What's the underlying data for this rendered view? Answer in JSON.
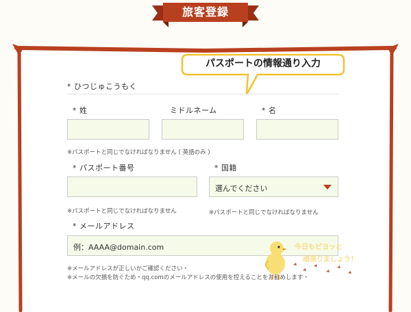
{
  "header": {
    "title": "旅客登録"
  },
  "callout": {
    "text": "パスポートの情報通り入力"
  },
  "kana": {
    "label": "* ひつじゅこうもく"
  },
  "name": {
    "surname_label": "* 姓",
    "middle_label": "ミドルネーム",
    "given_label": "* 名",
    "surname_value": "",
    "middle_value": "",
    "given_value": "",
    "note": "※パスポートと同じでなければなりません ( 英語のみ )"
  },
  "passport": {
    "label": "* パスポート番号",
    "value": "",
    "note": "※パスポートと同じでなければなりません"
  },
  "nationality": {
    "label": "* 国籍",
    "selected": "選んでください",
    "note": "※パスポートと同じでなければなりません"
  },
  "email": {
    "label": "* メールアドレス",
    "placeholder": "例：AAAA@domain.com",
    "note1": "※メールアドレスが正しいかご確認ください・",
    "note2": "※メールの欠損を防ぐため・qq.comのメールアドレスの使用を控えることをお勧めします・"
  },
  "decoration": {
    "line1": "今日もピヨッと",
    "line2": "頑張りましょう！"
  },
  "colors": {
    "accent": "#b9401f",
    "field_bg": "#f6fbe9",
    "callout_border": "#f2c230"
  }
}
